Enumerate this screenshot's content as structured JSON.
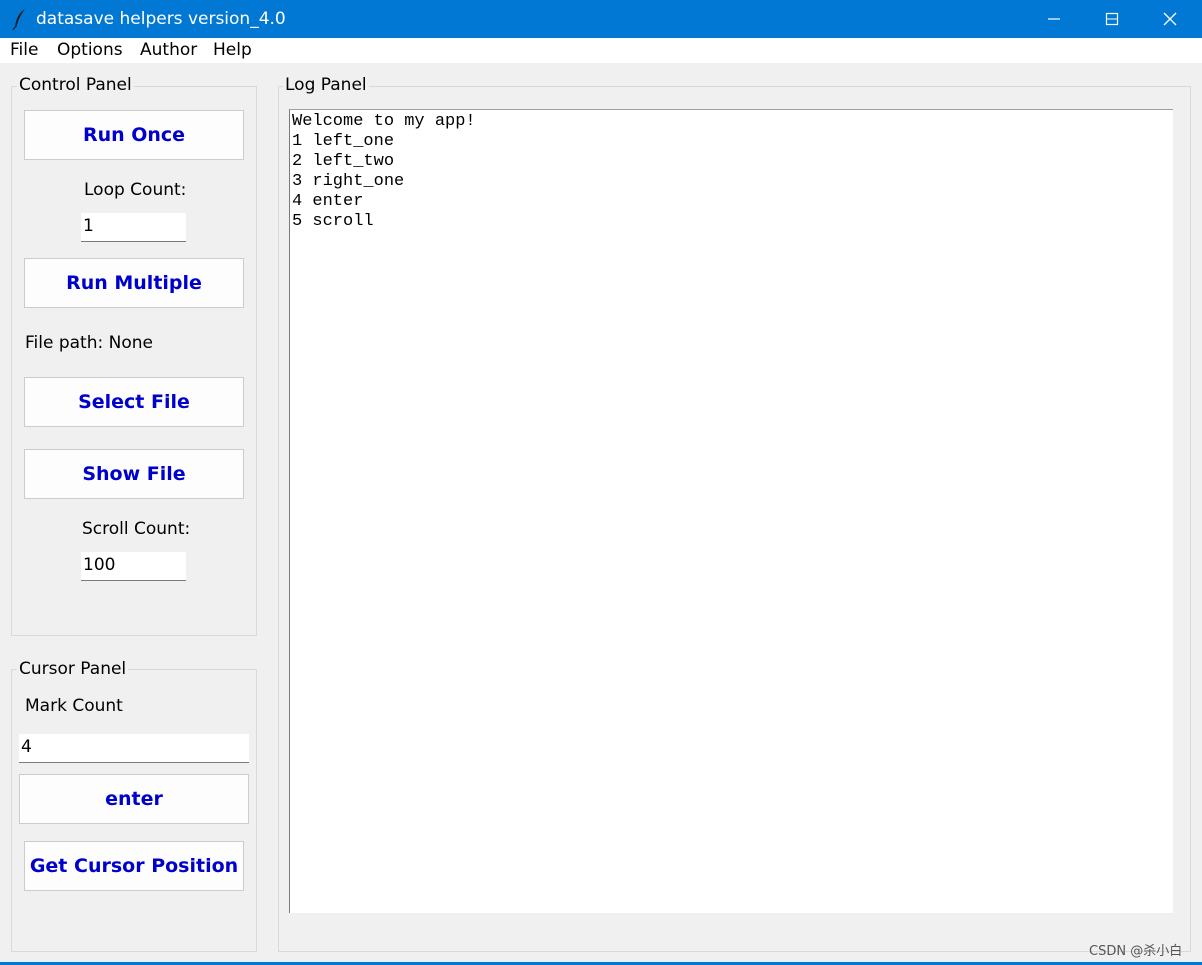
{
  "window": {
    "title": "datasave helpers version_4.0",
    "icon": "feather-icon",
    "accent": "#0078d4"
  },
  "menu": {
    "items": [
      "File",
      "Options",
      "Author",
      "Help"
    ]
  },
  "control_panel": {
    "label": "Control Panel",
    "run_once": "Run Once",
    "loop_count_label": "Loop Count:",
    "loop_count_value": "1",
    "run_multiple": "Run Multiple",
    "file_path": "File path: None",
    "select_file": "Select File",
    "show_file": "Show File",
    "scroll_count_label": "Scroll Count:",
    "scroll_count_value": "100"
  },
  "cursor_panel": {
    "label": "Cursor Panel",
    "mark_count_label": "Mark Count",
    "mark_count_value": "4",
    "enter": "enter",
    "get_cursor": "Get Cursor Position"
  },
  "log_panel": {
    "label": "Log Panel",
    "lines": [
      "Welcome to my app!",
      "1 left_one",
      "2 left_two",
      "3 right_one",
      "4 enter",
      "5 scroll"
    ]
  },
  "watermark": "CSDN @杀小白",
  "colors": {
    "button_text": "#0000cc",
    "titlebar": "#0078d4"
  }
}
